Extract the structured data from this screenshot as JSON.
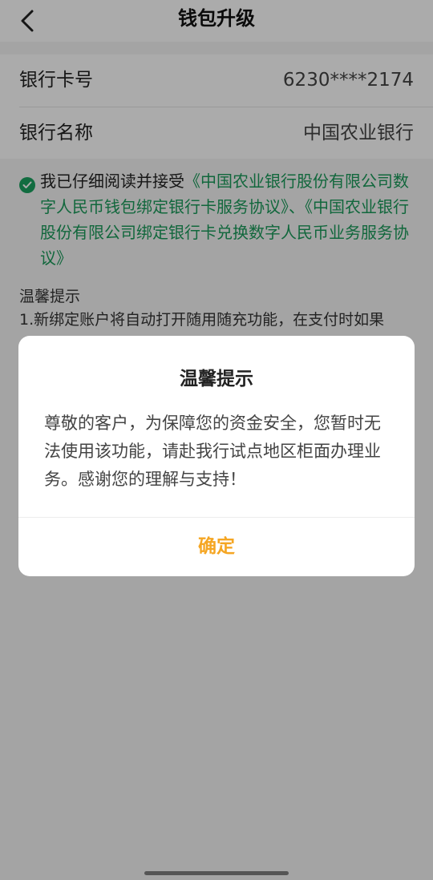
{
  "navbar": {
    "title": "钱包升级",
    "back_icon": "chevron-left-icon"
  },
  "card": {
    "rows": [
      {
        "label": "银行卡号",
        "value": "6230****2174"
      },
      {
        "label": "银行名称",
        "value": "中国农业银行"
      }
    ]
  },
  "agreement": {
    "checked": true,
    "prefix": "我已仔细阅读并接受",
    "link1": "《中国农业银行股份有限公司数字人民币钱包绑定银行卡服务协议》",
    "separator": "、",
    "link2": "《中国农业银行股份有限公司绑定银行卡兑换数字人民币业务服务协议》"
  },
  "tips": {
    "title": "温馨提示",
    "line1": "1.新绑定账户将自动打开随用随充功能，在支付时如果"
  },
  "dialog": {
    "title": "温馨提示",
    "body": "尊敬的客户，为保障您的资金安全，您暂时无法使用该功能，请赴我行试点地区柜面办理业务。感谢您的理解与支持！",
    "confirm_label": "确定"
  },
  "colors": {
    "accent_green": "#1a9a5a",
    "confirm_orange": "#f5a623"
  }
}
